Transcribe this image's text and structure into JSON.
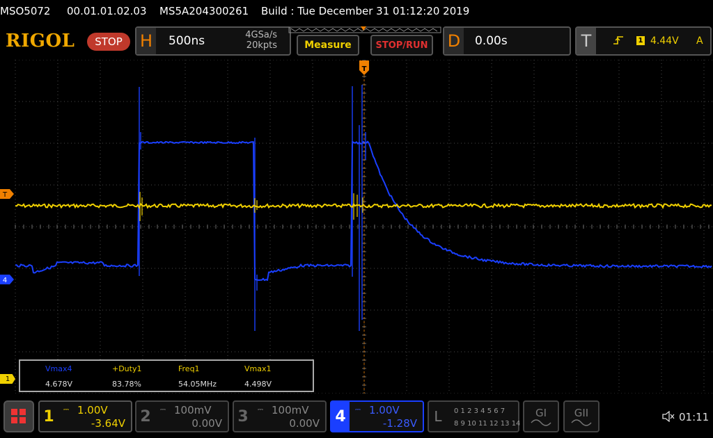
{
  "titlebar": {
    "model": "MSO5072",
    "firmware": "00.01.01.02.03",
    "serial": "MS5A204300261",
    "build": "Build : Tue December 31 01:12:20 2019"
  },
  "top": {
    "logo": "RIGOL",
    "status": "STOP",
    "horizontal": {
      "letter": "H",
      "timebase": "500ns",
      "sample_rate": "4GSa/s",
      "points": "20kpts"
    },
    "measure_label": "Measure",
    "stoprun_label": "STOP/RUN",
    "delay": {
      "letter": "D",
      "value": "0.00s"
    },
    "trigger": {
      "letter": "T",
      "source": "1",
      "level": "4.44V",
      "mode": "A"
    }
  },
  "markers": {
    "trigger_level": "T",
    "ch4": "4",
    "ch1_ref": "1"
  },
  "measurements": [
    {
      "label": "Vmax4",
      "value": "4.678V",
      "color": "#1a3fff"
    },
    {
      "label": "+Duty1",
      "value": "83.78%",
      "color": "#f0d000"
    },
    {
      "label": "Freq1",
      "value": "54.05MHz",
      "color": "#f0d000"
    },
    {
      "label": "Vmax1",
      "value": "4.498V",
      "color": "#f0d000"
    }
  ],
  "channels": {
    "ch1": {
      "num": "1",
      "scale": "1.00V",
      "offset": "-3.64V",
      "color": "#f0d000"
    },
    "ch2": {
      "num": "2",
      "scale": "100mV",
      "offset": "0.00V"
    },
    "ch3": {
      "num": "3",
      "scale": "100mV",
      "offset": "0.00V"
    },
    "ch4": {
      "num": "4",
      "scale": "1.00V",
      "offset": "-1.28V",
      "color": "#1a3fff"
    }
  },
  "logic": {
    "num": "L",
    "row1": "0 1 2 3   4 5 6 7",
    "row2": "8 9 10 11  12 13 14 15"
  },
  "generators": {
    "g1": "GI",
    "g2": "GII"
  },
  "status_bar": {
    "time": "01:11",
    "speaker_icon": "speaker-muted-icon"
  },
  "colors": {
    "ch1": "#f0d000",
    "ch4": "#1a3fff",
    "grid": "#555555",
    "brand": "#f0a800"
  }
}
